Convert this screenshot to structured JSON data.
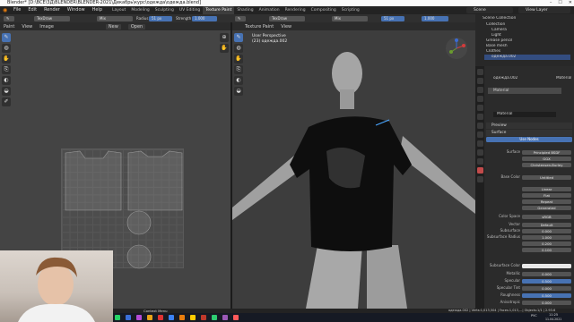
{
  "window": {
    "title": "Blender* [D:\\ВСЁ\\3Д\\BLENDER\\BLENDER-2021\\Декабрь\\курс\\одежда\\одежда.blend]",
    "controls": [
      "–",
      "☐",
      "✕"
    ]
  },
  "menu": {
    "items": [
      "File",
      "Edit",
      "Render",
      "Window",
      "Help"
    ],
    "workspace_tabs": [
      "Layout",
      "Modeling",
      "Sculpting",
      "UV Editing",
      "Texture Paint",
      "Shading",
      "Animation",
      "Rendering",
      "Compositing",
      "Scripting"
    ],
    "active_workspace": "Texture Paint",
    "scene": "Scene",
    "view_layer": "View Layer"
  },
  "tool_header": {
    "brush": "TexDraw",
    "blend_mode": "Mix",
    "radius_label": "Radius",
    "radius_value": "51 px",
    "strength_label": "Strength",
    "strength_value": "1.000",
    "brush_right": "TexDraw",
    "mix_right": "Mix",
    "radius_right": "51 px"
  },
  "uv_editor": {
    "mode": "Paint",
    "menus": [
      "View",
      "Image"
    ],
    "image_actions": [
      "New",
      "Open"
    ]
  },
  "viewport": {
    "menus": [
      "Texture Paint",
      "View"
    ],
    "info_line1": "User Perspective",
    "info_line2": "(23) одежда.002"
  },
  "outliner": {
    "title": "Scene Collection",
    "items": [
      "Collection",
      "Camera",
      "Light",
      "Grease pencil",
      "Base mesh",
      "Clothes",
      "одежда.002"
    ]
  },
  "properties": {
    "object_name": "одежда.002",
    "slot": "Material",
    "material_name": "Material",
    "sections": [
      "Preview",
      "Surface"
    ],
    "use_nodes": "Use Nodes",
    "rows": [
      {
        "label": "Surface",
        "value": "Principled BSDF"
      },
      {
        "label": "",
        "value": "GGX"
      },
      {
        "label": "",
        "value": "Christensen-Burley"
      },
      {
        "label": "Base Color",
        "value": "Untitled"
      },
      {
        "label": "",
        "value": "Linear"
      },
      {
        "label": "",
        "value": "Flat"
      },
      {
        "label": "",
        "value": "Repeat"
      },
      {
        "label": "",
        "value": "Generated"
      },
      {
        "label": "Color Space",
        "value": "sRGB"
      },
      {
        "label": "Vector",
        "value": "Default"
      },
      {
        "label": "Subsurface",
        "value": "0.000"
      },
      {
        "label": "Subsurface Radius",
        "value": "1.000"
      },
      {
        "label": "",
        "value": "0.200"
      },
      {
        "label": "",
        "value": "0.100"
      },
      {
        "label": "Subsurface Color",
        "value": ""
      },
      {
        "label": "Metallic",
        "value": "0.000"
      },
      {
        "label": "Specular",
        "value": "0.500"
      },
      {
        "label": "Specular Tint",
        "value": "0.000"
      },
      {
        "label": "Roughness",
        "value": "0.500"
      },
      {
        "label": "Anisotropic",
        "value": "0.000"
      }
    ]
  },
  "statusbar": {
    "left": "Context Menu",
    "right": "одежда.002 | Verts:1,013,504 | Faces:1,013,...| Objects:1/1 | 2.93.6"
  },
  "taskbar": {
    "time": "11:25",
    "date": "11.04.2021",
    "lang": "РУС"
  },
  "colors": {
    "accent": "#4772b3",
    "orange": "#e87d0d",
    "background": "#303030"
  }
}
